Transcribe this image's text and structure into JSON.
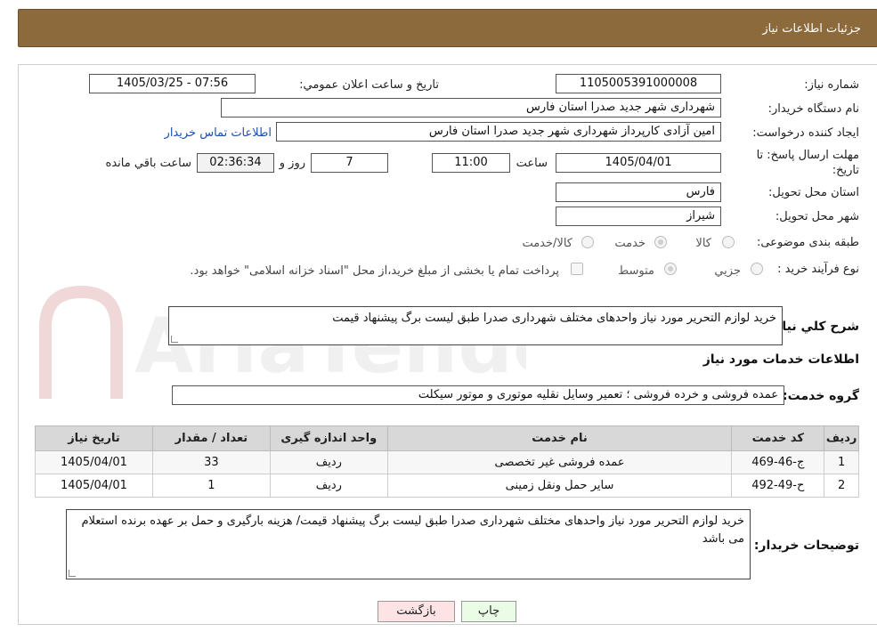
{
  "header": {
    "title": "جزئیات اطلاعات نیاز"
  },
  "fields": {
    "need_number_label": "شماره نیاز:",
    "need_number": "1105005391000008",
    "announce_label": "تاریخ و ساعت اعلان عمومي:",
    "announce_value": "1405/03/25 - 07:56",
    "buyer_org_label": "نام دستگاه خريدار:",
    "buyer_org": "شهرداری شهر جدید صدرا استان فارس",
    "requester_label": "ايجاد کننده درخواست:",
    "requester": "امین آزادی کارپرداز شهرداری شهر جدید صدرا استان فارس",
    "contact_link": "اطلاعات تماس خريدار",
    "deadline_label": "مهلت ارسال پاسخ: تا تاريخ:",
    "deadline_date": "1405/04/01",
    "time_label": "ساعت",
    "deadline_time": "11:00",
    "days_value": "7",
    "days_label": "روز و",
    "remaining_time": "02:36:34",
    "remaining_label": "ساعت باقي مانده",
    "province_label": "استان محل تحويل:",
    "province": "فارس",
    "city_label": "شهر محل تحويل:",
    "city": "شیراز",
    "category_label": "طبقه بندی موضوعی:",
    "category_options": [
      "کالا",
      "خدمت",
      "کالا/خدمت"
    ],
    "category_selected": "خدمت",
    "process_label": "نوع فرآيند خريد :",
    "process_options": [
      "جزيي",
      "متوسط"
    ],
    "payment_note": "پرداخت تمام يا بخشی از مبلغ خريد،از محل \"اسناد خزانه اسلامی\" خواهد بود.",
    "summary_label": "شرح کلي نياز:",
    "summary": "خرید لوازم التحریر مورد نیاز واحدهای مختلف شهرداری صدرا طبق لیست برگ پیشنهاد قیمت"
  },
  "services": {
    "section_title": "اطلاعات خدمات مورد نياز",
    "group_label": "گروه خدمت:",
    "group_value": "عمده فروشی و خرده فروشی ؛ تعمیر وسایل نقلیه موتوری و موتور سیکلت",
    "columns": [
      "رديف",
      "کد خدمت",
      "نام خدمت",
      "واحد اندازه گيری",
      "تعداد / مقدار",
      "تاريخ نياز"
    ],
    "rows": [
      {
        "row": "1",
        "code": "ج-46-469",
        "name": "عمده فروشی غیر تخصصی",
        "unit": "رديف",
        "qty": "33",
        "date": "1405/04/01"
      },
      {
        "row": "2",
        "code": "ح-49-492",
        "name": "سایر حمل ونقل زمینی",
        "unit": "رديف",
        "qty": "1",
        "date": "1405/04/01"
      }
    ]
  },
  "buyer_notes": {
    "label": "توضيحات خريدار:",
    "text": "خرید لوازم التحریر مورد نیاز واحدهای مختلف شهرداری صدرا طبق لیست برگ پیشنهاد قیمت/ هزینه بارگیری و حمل بر عهده برنده استعلام می باشد"
  },
  "actions": {
    "print": "چاپ",
    "back": "بازگشت"
  },
  "colors": {
    "header_bg": "#8c6a3c",
    "back_btn_bg": "#fde3e3",
    "print_btn_bg": "#eafbe6"
  },
  "watermark": {
    "text": "AriaTender.neT"
  }
}
